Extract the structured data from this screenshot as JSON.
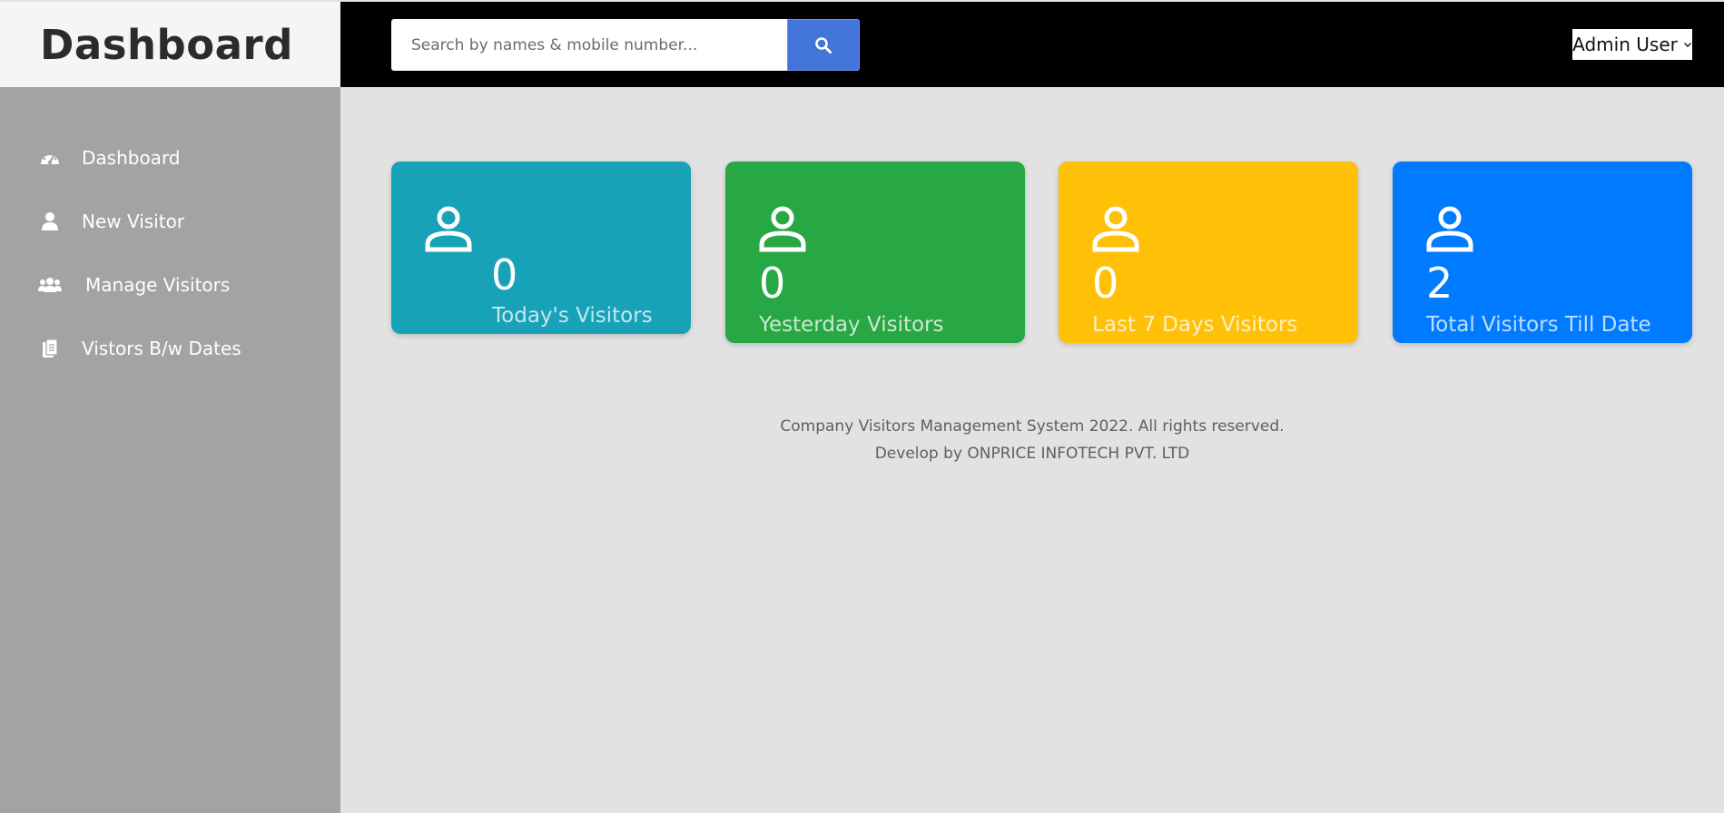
{
  "brand": {
    "title": "Dashboard"
  },
  "search": {
    "placeholder": "Search by names & mobile number..."
  },
  "user": {
    "name": "Admin User"
  },
  "sidebar": {
    "items": [
      {
        "label": "Dashboard",
        "icon": "tachometer-icon"
      },
      {
        "label": "New Visitor",
        "icon": "user-icon"
      },
      {
        "label": "Manage Visitors",
        "icon": "users-icon"
      },
      {
        "label": "Vistors B/w Dates",
        "icon": "files-icon"
      }
    ]
  },
  "cards": [
    {
      "value": "0",
      "label": "Today's Visitors",
      "color": "#17a2b8"
    },
    {
      "value": "0",
      "label": "Yesterday Visitors",
      "color": "#28a745"
    },
    {
      "value": "0",
      "label": "Last 7 Days Visitors",
      "color": "#ffc107"
    },
    {
      "value": "2",
      "label": "Total Visitors Till Date",
      "color": "#007bff"
    }
  ],
  "footer": {
    "line1": "Company Visitors Management System 2022. All rights reserved.",
    "line2": "Develop by ONPRICE INFOTECH PVT. LTD"
  }
}
